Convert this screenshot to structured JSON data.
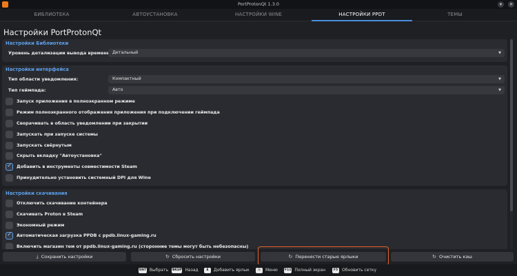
{
  "window": {
    "title": "PortProtonQt 1.3.0",
    "buttons": [
      "▾",
      "✕"
    ]
  },
  "tabs": [
    {
      "label": "БИБЛИОТЕКА",
      "active": false
    },
    {
      "label": "АВТОУСТАНОВКА",
      "active": false
    },
    {
      "label": "НАСТРОЙКИ WINE",
      "active": false
    },
    {
      "label": "НАСТРОЙКИ PPDT",
      "active": true
    },
    {
      "label": "ТЕМЫ",
      "active": false
    }
  ],
  "page_title": "Настройки PortProtonQt",
  "library": {
    "title": "Настройки Библиотеки",
    "time_detail_label": "Уровень детализации вывода времени:",
    "time_detail_value": "Детальный"
  },
  "interface": {
    "title": "Настройки интерфейса",
    "tray_label": "Тип области уведомления:",
    "tray_value": "Компактный",
    "gamepad_label": "Тип геймпада:",
    "gamepad_value": "Авто",
    "checkboxes": [
      {
        "label": "Запуск приложения в полноэкранном режиме",
        "checked": false
      },
      {
        "label": "Режим полноэкранного отображения приложения при подключении геймпада",
        "checked": false
      },
      {
        "label": "Сворачивать в область уведомлении при закрытии",
        "checked": false
      },
      {
        "label": "Запускать при запуске системы",
        "checked": false
      },
      {
        "label": "Запускать свёрнутым",
        "checked": false
      },
      {
        "label": "Скрыть вкладку \"Автоустановка\"",
        "checked": false
      },
      {
        "label": "Добавить в инструменты совместимости Steam",
        "checked": true
      },
      {
        "label": "Принудительно установить системный DPI для Wine",
        "checked": false
      }
    ]
  },
  "downloads": {
    "title": "Настройки скачивания",
    "checkboxes": [
      {
        "label": "Отключить скачивание контейнера",
        "checked": false
      },
      {
        "label": "Скачивать Proton в Steam",
        "checked": false
      },
      {
        "label": "Экономный режим",
        "checked": false
      },
      {
        "label": "Автоматическая загрузка PPDB с ppdb.linux-gaming.ru",
        "checked": true
      },
      {
        "label": "Включить магазин тем от ppdb.linux-gaming.ru (сторонние темы могут быть небезопасны)",
        "checked": false
      }
    ]
  },
  "actions": [
    {
      "label": "Сохранить настройки",
      "icon": "save-icon",
      "glyph": "⤓"
    },
    {
      "label": "Сбросить настройки",
      "icon": "reset-icon",
      "glyph": "↻"
    },
    {
      "label": "Перенести старые ярлыки",
      "icon": "migrate-icon",
      "glyph": "↻"
    },
    {
      "label": "Очистить кэш",
      "icon": "clear-cache-icon",
      "glyph": "↻"
    }
  ],
  "hints": [
    {
      "key": "ENT",
      "label": "Выбрать"
    },
    {
      "key": "BKSP",
      "label": "Назад"
    },
    {
      "key": "E",
      "label": "Добавить ярлык"
    },
    {
      "key": "☰",
      "label": "Меню"
    },
    {
      "key": "F11",
      "label": "Полный экран"
    },
    {
      "key": "F5",
      "label": "Обновить сетку"
    }
  ],
  "colors": {
    "accent": "#5b9ee8",
    "focus": "#e8642a",
    "background": "#1f2024"
  }
}
